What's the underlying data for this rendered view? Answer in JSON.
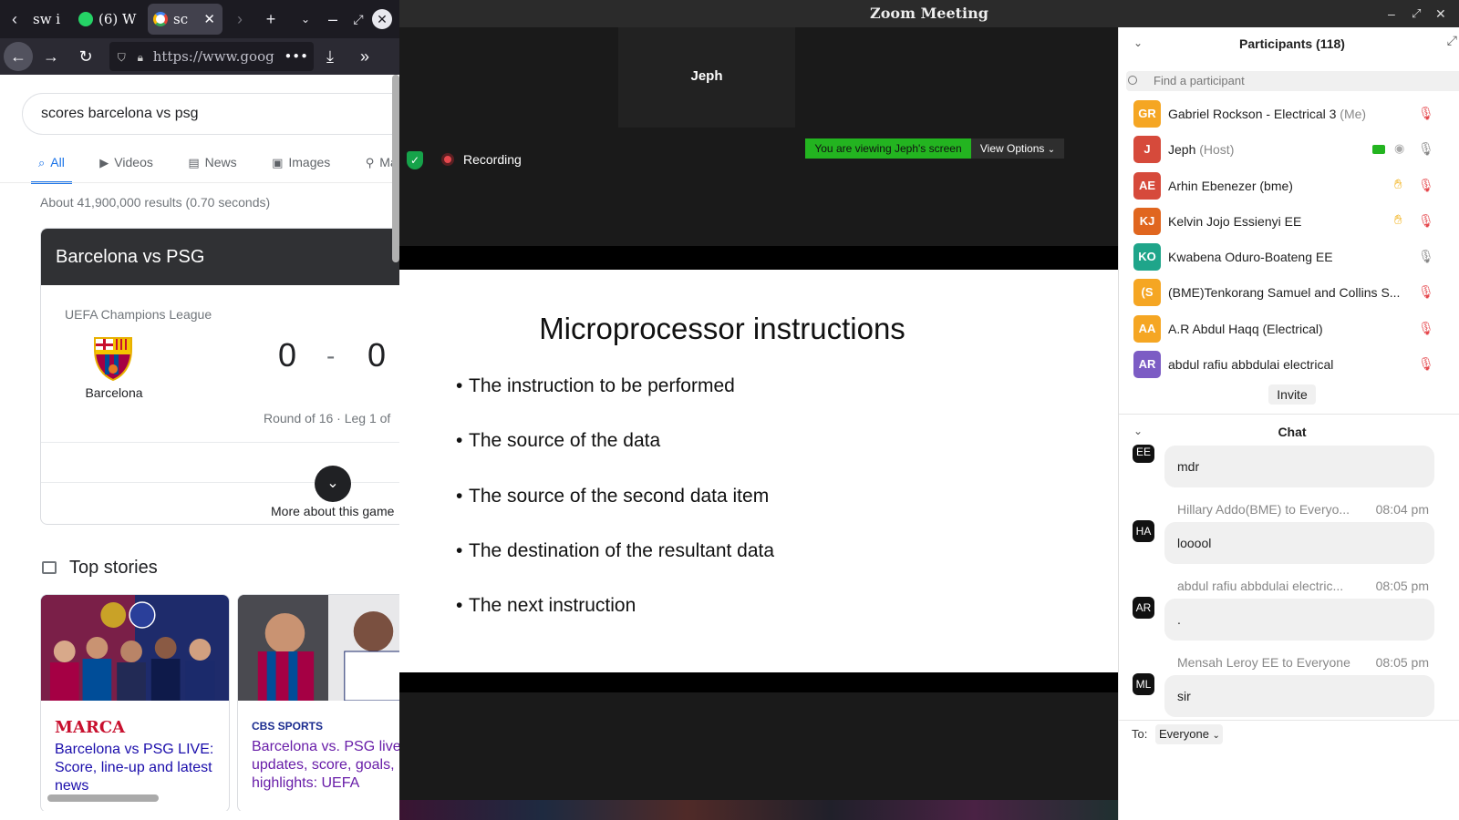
{
  "browser": {
    "tabs": [
      {
        "label": "sw i",
        "active": false
      },
      {
        "label": "(6) W",
        "active": false,
        "icon": "whatsapp-icon",
        "badge": "6"
      },
      {
        "label": "sc",
        "active": true,
        "icon": "google-icon"
      }
    ],
    "url": "https://www.goog",
    "icons": {
      "back": "arrow-left-icon",
      "forward": "arrow-right-icon",
      "reload": "reload-icon",
      "shield": "tracking-shield-icon",
      "lock": "lock-icon",
      "download": "download-icon",
      "overflow": "chevrons-right-icon"
    }
  },
  "google": {
    "query": "scores barcelona vs psg",
    "tabs": [
      {
        "label": "All",
        "icon": "search-icon",
        "active": true
      },
      {
        "label": "Videos",
        "icon": "video-icon"
      },
      {
        "label": "News",
        "icon": "news-icon"
      },
      {
        "label": "Images",
        "icon": "image-icon"
      },
      {
        "label": "Maps",
        "icon": "map-pin-icon"
      }
    ],
    "result_stats": "About 41,900,000 results (0.70 seconds)",
    "match_card": {
      "title": "Barcelona vs PSG",
      "competition": "UEFA Champions League",
      "home_team": "Barcelona",
      "home_score": "0",
      "separator": "-",
      "away_score": "0",
      "round": "Round of 16 · Leg 1 of",
      "more_about": "More about this game"
    },
    "top_stories": {
      "heading": "Top stories",
      "stories": [
        {
          "source": "MARCA",
          "source_color": "#c8102e",
          "title": "Barcelona vs PSG LIVE: Score, line-up and latest news"
        },
        {
          "source": "CBS SPORTS",
          "source_color": "#1a2b8f",
          "title": "Barcelona vs. PSG live updates, score, goals, highlights: UEFA"
        }
      ]
    }
  },
  "zoom": {
    "window_title": "Zoom Meeting",
    "video_tile_name": "Jeph",
    "recording_label": "Recording",
    "viewing_banner": "You are viewing Jeph's screen",
    "view_options": "View Options",
    "slide": {
      "title": "Microprocessor instructions",
      "bullets": [
        "The instruction to be performed",
        "The source of the data",
        "The source of the second data item",
        "The destination of the resultant data",
        "The next instruction"
      ]
    },
    "participants_panel": {
      "title": "Participants (118)",
      "search_placeholder": "Find a participant",
      "participants": [
        {
          "initials": "GR",
          "name": "Gabriel Rockson - Electrical 3",
          "role": "(Me)",
          "color": "#f5a623",
          "muted": true
        },
        {
          "initials": "J",
          "name": "Jeph",
          "role": "(Host)",
          "color": "#d64a3b",
          "muted": false,
          "sharing": true
        },
        {
          "initials": "AE",
          "name": "Arhin Ebenezer (bme)",
          "role": "",
          "color": "#d64a3b",
          "muted": true,
          "hand_raised": true
        },
        {
          "initials": "KJ",
          "name": "Kelvin Jojo Essienyi EE",
          "role": "",
          "color": "#e0661f",
          "muted": true,
          "hand_raised": true
        },
        {
          "initials": "KO",
          "name": "Kwabena Oduro-Boateng EE",
          "role": "",
          "color": "#1fa58a",
          "muted": false
        },
        {
          "initials": "(S",
          "name": "(BME)Tenkorang Samuel and Collins S...",
          "role": "",
          "color": "#f5a623",
          "muted": true
        },
        {
          "initials": "AA",
          "name": "A.R Abdul Haqq (Electrical)",
          "role": "",
          "color": "#f5a623",
          "muted": true
        },
        {
          "initials": "AR",
          "name": "abdul rafiu abbdulai electrical",
          "role": "",
          "color": "#7c5cc4",
          "muted": true
        }
      ],
      "invite_label": "Invite"
    },
    "chat": {
      "title": "Chat",
      "messages": [
        {
          "avatar": "EE",
          "sender": "",
          "time": "",
          "text": "mdr"
        },
        {
          "avatar": "HA",
          "sender": "Hillary Addo(BME) to Everyo...",
          "time": "08:04 pm",
          "text": "looool"
        },
        {
          "avatar": "AR",
          "sender": "abdul rafiu abbdulai electric...",
          "time": "08:05 pm",
          "text": "."
        },
        {
          "avatar": "ML",
          "sender": "Mensah Leroy EE to Everyone",
          "time": "08:05 pm",
          "text": "sir"
        }
      ],
      "to_label": "To:",
      "recipient": "Everyone"
    }
  }
}
